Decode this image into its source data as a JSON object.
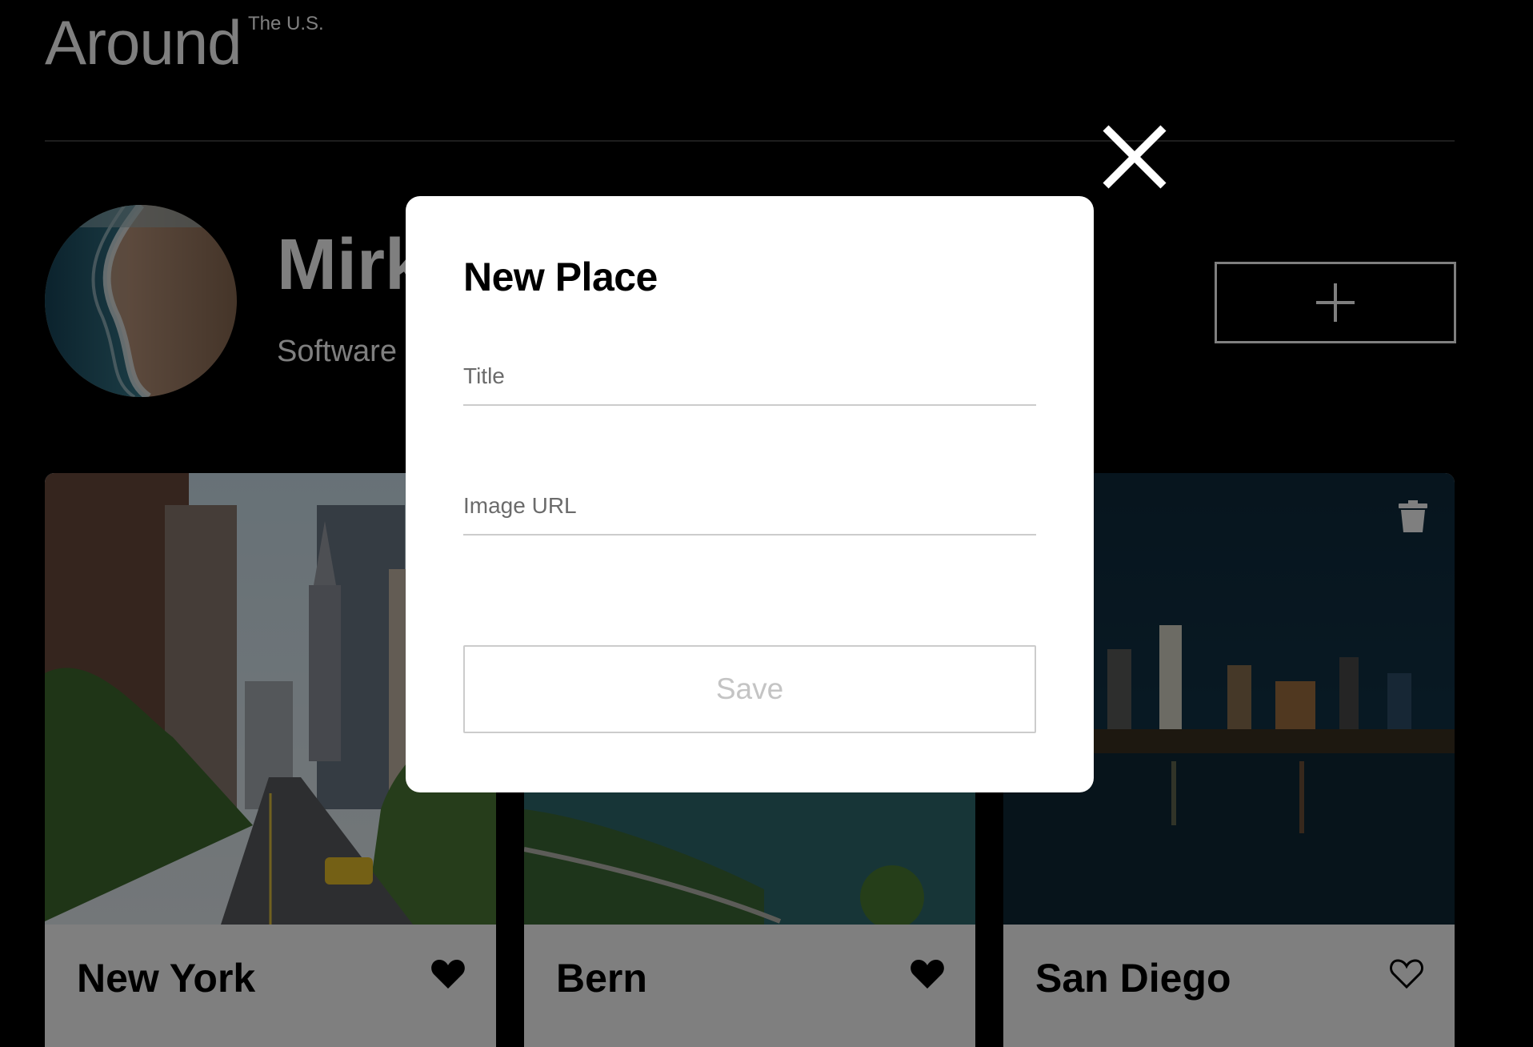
{
  "header": {
    "logo_main": "Around",
    "logo_sup": "The U.S."
  },
  "profile": {
    "name": "Mirk",
    "about": "Software",
    "add_button_icon": "plus-icon"
  },
  "cards": [
    {
      "title": "New York",
      "liked": true,
      "image": "new-york-street-photo"
    },
    {
      "title": "Bern",
      "liked": true,
      "image": "bern-river-photo"
    },
    {
      "title": "San Diego",
      "liked": false,
      "image": "san-diego-night-skyline-photo",
      "deletable": true
    }
  ],
  "popup": {
    "title": "New Place",
    "title_placeholder": "Title",
    "url_placeholder": "Image URL",
    "save_label": "Save",
    "close_icon": "close-icon"
  },
  "colors": {
    "background": "#000000",
    "card_footer": "#ffffff",
    "popup_background": "#ffffff",
    "overlay": "rgba(0,0,0,0.5)"
  }
}
